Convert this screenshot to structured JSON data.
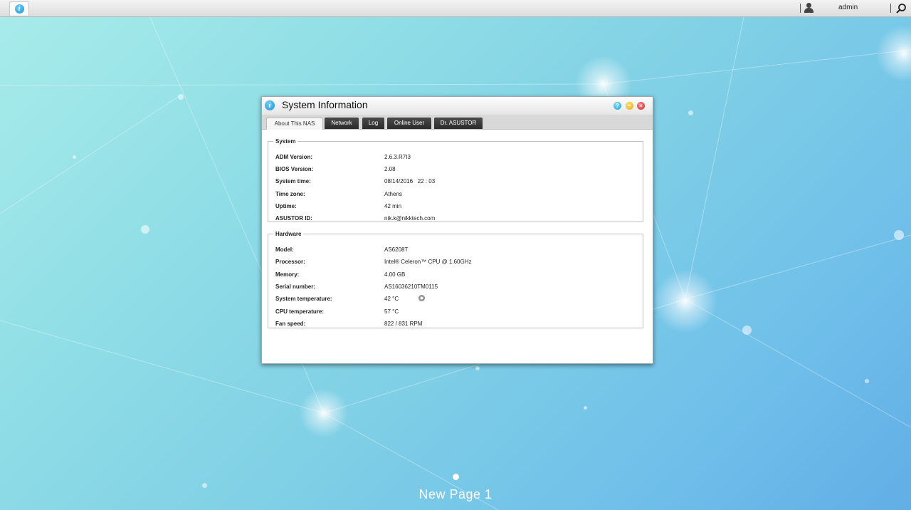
{
  "topbar": {
    "username": "admin"
  },
  "window": {
    "title": "System Information",
    "tabs": [
      "About This NAS",
      "Network",
      "Log",
      "Online User",
      "Dr. ASUSTOR"
    ],
    "active_tab": "About This NAS",
    "system": {
      "legend": "System",
      "rows": [
        {
          "label": "ADM Version:",
          "value": "2.6.3.R7I3"
        },
        {
          "label": "BIOS Version:",
          "value": "2.08"
        },
        {
          "label": "System time:",
          "value": "08/14/2016   22 : 03"
        },
        {
          "label": "Time zone:",
          "value": "Athens"
        },
        {
          "label": "Uptime:",
          "value": "42 min"
        },
        {
          "label": "ASUSTOR ID:",
          "value": "nik.k@nikktech.com"
        }
      ]
    },
    "hardware": {
      "legend": "Hardware",
      "rows": [
        {
          "label": "Model:",
          "value": "AS6208T"
        },
        {
          "label": "Processor:",
          "value": "Intel® Celeron™ CPU @ 1.60GHz"
        },
        {
          "label": "Memory:",
          "value": "4.00 GB"
        },
        {
          "label": "Serial number:",
          "value": "AS16036210TM0115"
        },
        {
          "label": "System temperature:",
          "value": "42 °C"
        },
        {
          "label": "CPU temperature:",
          "value": "57 °C"
        },
        {
          "label": "Fan speed:",
          "value": "822 / 831 RPM"
        }
      ]
    }
  },
  "desktop": {
    "page_label": "New Page 1"
  }
}
